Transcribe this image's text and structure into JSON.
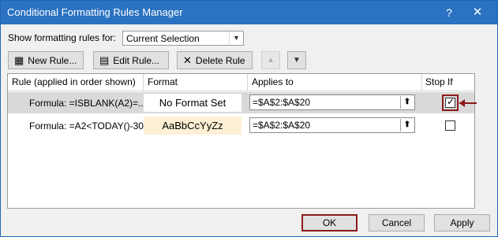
{
  "window": {
    "title": "Conditional Formatting Rules Manager",
    "help": "?",
    "close": "✕"
  },
  "show_rules": {
    "label": "Show formatting rules for:",
    "selected": "Current Selection"
  },
  "toolbar": {
    "new_rule": "New Rule...",
    "edit_rule": "Edit Rule...",
    "delete_rule": "Delete Rule"
  },
  "columns": {
    "rule": "Rule (applied in order shown)",
    "format": "Format",
    "applies": "Applies to",
    "stop": "Stop If True"
  },
  "rules": [
    {
      "rule": "Formula: =ISBLANK(A2)=...",
      "format": "No Format Set",
      "applies_to": "=$A$2:$A$20",
      "stop_if_true": true
    },
    {
      "rule": "Formula: =A2<TODAY()-30",
      "format": "AaBbCcYyZz",
      "applies_to": "=$A$2:$A$20",
      "stop_if_true": false
    }
  ],
  "buttons": {
    "ok": "OK",
    "cancel": "Cancel",
    "apply": "Apply"
  },
  "colors": {
    "titlebar": "#2b72c2",
    "highlight": "#8b1a1a",
    "format_preview_bg": "#fdf0d5"
  }
}
